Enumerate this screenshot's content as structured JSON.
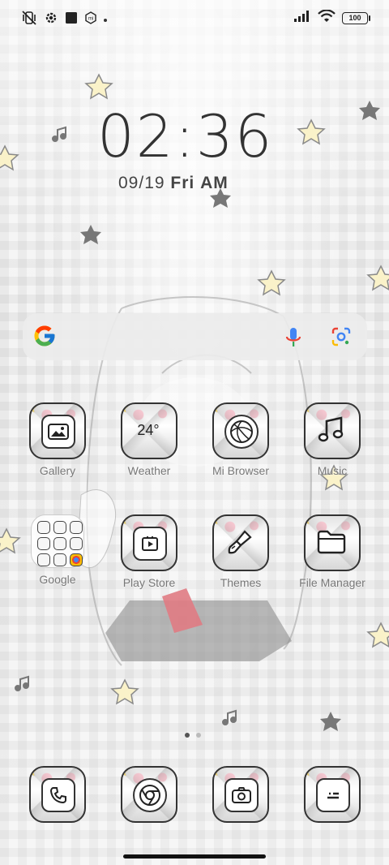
{
  "status_bar": {
    "left_icons": [
      "vibrate-mute-icon",
      "settings-gear-icon",
      "square-notification-icon",
      "mi-app-icon"
    ],
    "right_icons": [
      "signal-icon",
      "wifi-icon",
      "battery-icon"
    ],
    "battery_level": "100"
  },
  "clock": {
    "time": "02:36",
    "date": "09/19",
    "weekday": "Fri",
    "ampm": "AM"
  },
  "search_bar": {
    "icons": [
      "google-logo-icon",
      "microphone-icon",
      "google-lens-icon"
    ]
  },
  "apps": {
    "gallery": "Gallery",
    "weather": "Weather",
    "weather_temp": "24°",
    "mi_browser": "Mi Browser",
    "music": "Music",
    "google": "Google",
    "play_store": "Play Store",
    "themes": "Themes",
    "file_manager": "File Manager"
  },
  "dock": [
    "phone-icon",
    "chrome-icon",
    "camera-icon",
    "messages-icon"
  ],
  "page_indicator": {
    "pages": 2,
    "current": 1
  },
  "colors": {
    "text_dark": "#333333",
    "label": "#777777",
    "star": "#f1d36a",
    "accent_blue": "#4285F4"
  }
}
